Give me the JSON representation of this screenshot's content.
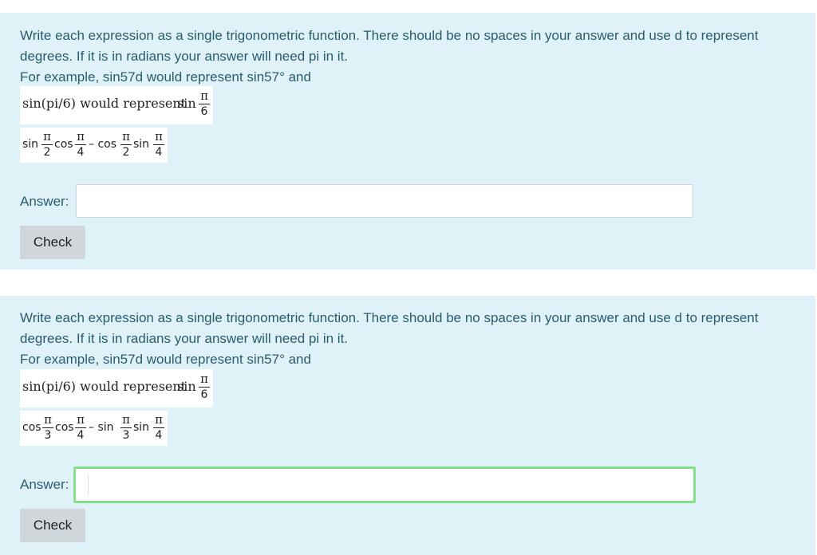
{
  "questions": [
    {
      "instructions_line1": "Write each expression as a single trigonometric function.  There should be no spaces in your answer and use d to represent degrees.  If it is in radians your answer will need pi in it.",
      "instructions_line2": "For example, sin57d would represent sin57° and",
      "example_text": "sin(pi/6) would represent",
      "example_fn": "sin",
      "example_num": "π",
      "example_den": "6",
      "expression": {
        "terms": [
          "sin",
          "cos",
          "– cos",
          "sin"
        ],
        "nums": [
          "π",
          "π",
          "π",
          "π"
        ],
        "dens": [
          "2",
          "4",
          "2",
          "4"
        ]
      },
      "answer_label": "Answer:",
      "answer_value": "",
      "check_label": "Check"
    },
    {
      "instructions_line1": "Write each expression as a single trigonometric function.  There should be no spaces in your answer and use d to represent degrees.  If it is in radians your answer will need pi in it.",
      "instructions_line2": "For example, sin57d would represent sin57° and",
      "example_text": "sin(pi/6) would represent",
      "example_fn": "sin",
      "example_num": "π",
      "example_den": "6",
      "expression": {
        "terms": [
          "cos",
          "cos",
          "– sin",
          "sin"
        ],
        "nums": [
          "π",
          "π",
          "π",
          "π"
        ],
        "dens": [
          "3",
          "4",
          "3",
          "4"
        ]
      },
      "answer_label": "Answer:",
      "answer_value": "",
      "check_label": "Check"
    }
  ],
  "colors": {
    "panel_bg": "#def2f8",
    "text": "#2a5d6c",
    "focus_border": "#84e08b",
    "button_bg": "#cfd7dc"
  }
}
